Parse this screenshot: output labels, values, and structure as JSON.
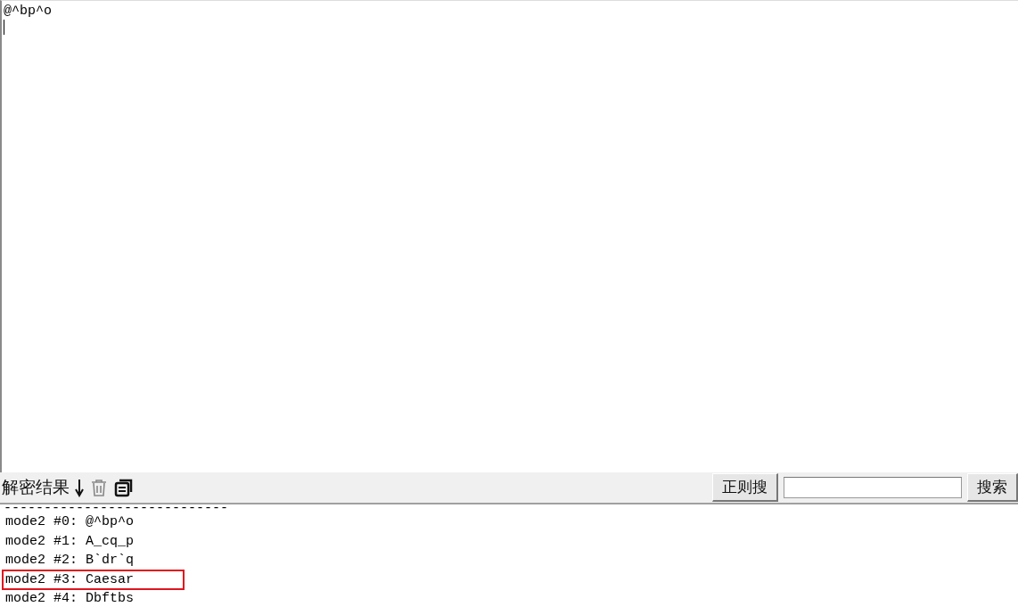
{
  "editor": {
    "text": "@^bp^o"
  },
  "results_toolbar": {
    "title": "解密结果",
    "regex_button": "正则搜",
    "search_button": "搜索"
  },
  "results": {
    "separator": "----------------------------",
    "rows": [
      {
        "text": "mode2 #0: @^bp^o",
        "highlighted": false
      },
      {
        "text": "mode2 #1: A_cq_p",
        "highlighted": false
      },
      {
        "text": "mode2 #2: B`dr`q",
        "highlighted": false
      },
      {
        "text": "mode2 #3: Caesar",
        "highlighted": true
      },
      {
        "text": "mode2 #4: Dbftbs",
        "highlighted": false
      }
    ]
  }
}
